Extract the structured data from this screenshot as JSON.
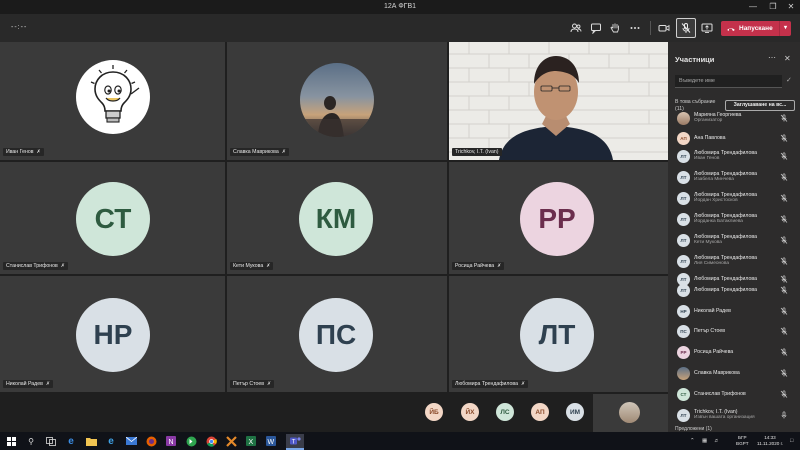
{
  "window": {
    "title": "12А ФГВ1"
  },
  "toolbar": {
    "timer": "--:--",
    "leave_label": "Напускане",
    "colors": {
      "leave": "#c4314b",
      "bar": "#292929"
    }
  },
  "tiles": {
    "ivan": {
      "name": "Иван Генов"
    },
    "slavka": {
      "name": "Славка Маврикова"
    },
    "trichkov": {
      "name": "Trichkov, I.T. (Ivan)"
    },
    "st": {
      "initials": "СТ",
      "name": "Станислав Трифонов"
    },
    "km": {
      "initials": "КМ",
      "name": "Кети Мукова"
    },
    "rr": {
      "initials": "РР",
      "name": "Росица Райчева"
    },
    "nr": {
      "initials": "НР",
      "name": "Николай Радев"
    },
    "ps": {
      "initials": "ПС",
      "name": "Петър Стоев"
    },
    "lt": {
      "initials": "ЛТ",
      "name": "Любомира Трендафилова"
    }
  },
  "strip": {
    "avatars": [
      "ЙБ",
      "ЙХ",
      "ЛС",
      "АП",
      "ИМ"
    ]
  },
  "panel": {
    "title": "Участници",
    "search_placeholder": "Въведете име",
    "in_meeting_line1": "В това събрание",
    "in_meeting_line2": "(11)",
    "mute_all": "Заглушаване на вс...",
    "footer": "Предложени (1)",
    "participants": [
      {
        "initials": "",
        "name": "Марияна Георгиева",
        "sub": "Организатор"
      },
      {
        "initials": "АП",
        "name": "Ана Павлова",
        "sub": ""
      },
      {
        "initials": "ЛТ",
        "name": "Любомира Трендафилова",
        "sub": "Иван Генов"
      },
      {
        "initials": "ЛТ",
        "name": "Любомира Трендафилова",
        "sub": "Изабела Минчева"
      },
      {
        "initials": "ЛТ",
        "name": "Любомира Трендафилова",
        "sub": "Йордан Христосков"
      },
      {
        "initials": "ЛТ",
        "name": "Любомира Трендафилова",
        "sub": "Йорданка Батаклиева"
      },
      {
        "initials": "ЛТ",
        "name": "Любомира Трендафилова",
        "sub": "Кети Мукова"
      },
      {
        "initials": "ЛТ",
        "name": "Любомира Трендафилова",
        "sub": "Лия Симеонова"
      },
      {
        "initials": "ЛТ",
        "name": "Любомира Трендафилова",
        "sub": ""
      },
      {
        "initials": "ЛТ",
        "name": "Любомира Трендафилова",
        "sub": ""
      },
      {
        "initials": "НР",
        "name": "Николай Радев",
        "sub": ""
      },
      {
        "initials": "ПС",
        "name": "Петър Стоев",
        "sub": ""
      },
      {
        "initials": "РР",
        "name": "Росица Райчева",
        "sub": ""
      },
      {
        "initials": "",
        "name": "Славка Маврикова",
        "sub": ""
      },
      {
        "initials": "СТ",
        "name": "Станислав Трифонов",
        "sub": ""
      },
      {
        "initials": "ЛТ",
        "name": "Trichkov, I.T. (Ivan)",
        "sub": "Извън вашата организация"
      }
    ]
  },
  "taskbar": {
    "lang_line1": "БГР",
    "lang_line2": "BGPT",
    "time": "14:33",
    "date": "11.11.2020 г."
  },
  "colors": {
    "avatar_green_bg": "#cfe6d9",
    "avatar_green_fg": "#2e5b40",
    "avatar_pink_bg": "#ecd4e0",
    "avatar_pink_fg": "#6b2d4d",
    "avatar_gray_bg": "#d9e0e6",
    "avatar_gray_fg": "#2f4150",
    "avatar_peach_bg": "#f3d7c6",
    "avatar_peach_fg": "#8a4a2a"
  }
}
